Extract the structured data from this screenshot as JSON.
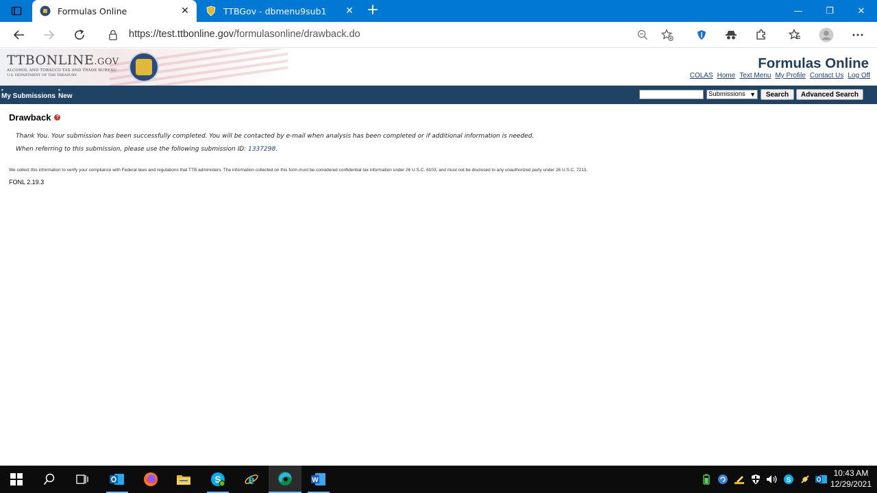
{
  "browser": {
    "tabs": [
      {
        "title": "Formulas Online",
        "active": true
      },
      {
        "title": "TTBGov - dbmenu9sub1",
        "active": false
      }
    ],
    "url_host": "https://test.ttbonline.gov",
    "url_path": "/formulasonline/drawback.do"
  },
  "site": {
    "logo_main": "TTBONLINE",
    "logo_tld": ".GOV",
    "logo_sub": "ALCOHOL AND TOBACCO TAX AND TRADE BUREAU",
    "logo_sub2": "U.S. DEPARTMENT OF THE TREASURY",
    "app_title": "Formulas Online",
    "top_links": [
      "COLAS",
      "Home",
      "Text Menu",
      "My Profile",
      "Contact Us",
      "Log Off"
    ]
  },
  "nav": {
    "my_submissions": "My Submissions",
    "new": "New",
    "search_value": "",
    "search_scope": "Submissions",
    "search_button": "Search",
    "advanced_button": "Advanced Search"
  },
  "content": {
    "title": "Drawback",
    "help_glyph": "?",
    "message_1": "Thank You. Your submission has been successfully completed. You will be contacted by e-mail when analysis has been completed or if additional information is needed.",
    "message_2_prefix": "When referring to this submission, please use the following submission ID: ",
    "submission_id": "1337298",
    "message_2_suffix": ".",
    "legal": "We collect this information to verify your compliance with Federal laws and regulations that TTB administers. The information collected on this form must be considered confidential tax information under 26 U.S.C. 6103, and must not be disclosed to any unauthorized party under 26 U.S.C. 7213.",
    "version": "FONL 2.19.3"
  },
  "taskbar": {
    "time": "10:43 AM",
    "date": "12/29/2021",
    "apps": [
      "start-icon",
      "search-icon",
      "task-view-icon",
      "outlook-icon",
      "firefox-icon",
      "file-explorer-icon",
      "skype-icon",
      "internet-explorer-icon",
      "edge-icon",
      "word-icon"
    ]
  },
  "colors": {
    "tabstrip": "#0078d4",
    "site_nav": "#1f4364",
    "app_title": "#1f3e5e",
    "link": "#1f3e7a"
  }
}
